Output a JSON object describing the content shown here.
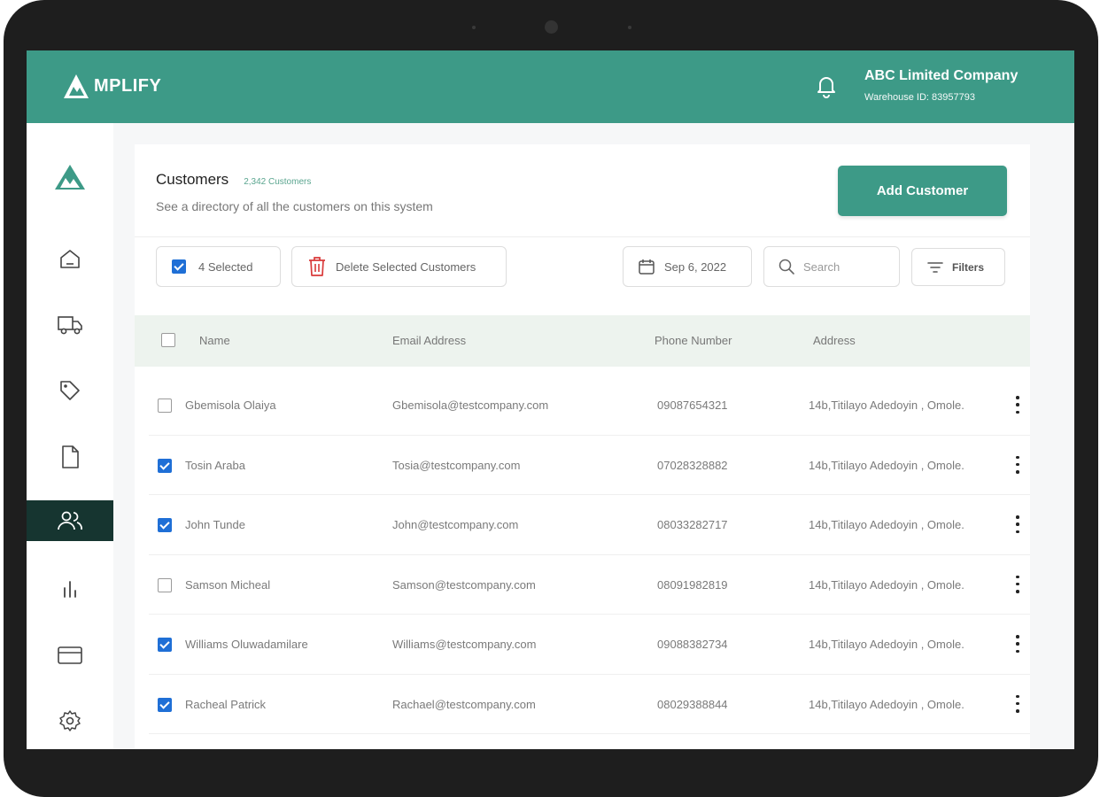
{
  "app": {
    "brand": "MPLIFY",
    "accent": "#3d9a87",
    "active_nav_bg": "#163530"
  },
  "header": {
    "company_name": "ABC Limited Company",
    "warehouse": "Warehouse ID: 83957793",
    "bell_icon": "bell-icon"
  },
  "sidebar": {
    "items": [
      {
        "icon": "home-icon",
        "active": false
      },
      {
        "icon": "truck-icon",
        "active": false
      },
      {
        "icon": "tag-icon",
        "active": false
      },
      {
        "icon": "file-icon",
        "active": false
      },
      {
        "icon": "users-icon",
        "active": true
      },
      {
        "icon": "bar-chart-icon",
        "active": false
      },
      {
        "icon": "credit-card-icon",
        "active": false
      },
      {
        "icon": "gear-icon",
        "active": false
      }
    ]
  },
  "page": {
    "title": "Customers",
    "count": "2,342 Customers",
    "subtitle": "See a directory of all the customers on this system",
    "add_button": "Add Customer"
  },
  "toolbar": {
    "selected_label": "4 Selected",
    "delete_label": "Delete Selected Customers",
    "date_label": "Sep 6, 2022",
    "search_placeholder": "Search",
    "filters_label": "Filters"
  },
  "table": {
    "headers": {
      "name": "Name",
      "email": "Email Address",
      "phone": "Phone Number",
      "address": "Address"
    },
    "rows": [
      {
        "checked": false,
        "name": "Gbemisola Olaiya",
        "email": "Gbemisola@testcompany.com",
        "phone": "09087654321",
        "address": "14b,Titilayo Adedoyin , Omole."
      },
      {
        "checked": true,
        "name": "Tosin Araba",
        "email": "Tosia@testcompany.com",
        "phone": "07028328882",
        "address": "14b,Titilayo Adedoyin , Omole."
      },
      {
        "checked": true,
        "name": "John Tunde",
        "email": "John@testcompany.com",
        "phone": "08033282717",
        "address": "14b,Titilayo Adedoyin , Omole."
      },
      {
        "checked": false,
        "name": "Samson Micheal",
        "email": "Samson@testcompany.com",
        "phone": "08091982819",
        "address": "14b,Titilayo Adedoyin , Omole."
      },
      {
        "checked": true,
        "name": "Williams Oluwadamilare",
        "email": "Williams@testcompany.com",
        "phone": "09088382734",
        "address": "14b,Titilayo Adedoyin , Omole."
      },
      {
        "checked": true,
        "name": "Racheal Patrick",
        "email": "Rachael@testcompany.com",
        "phone": "08029388844",
        "address": "14b,Titilayo Adedoyin , Omole."
      }
    ]
  }
}
